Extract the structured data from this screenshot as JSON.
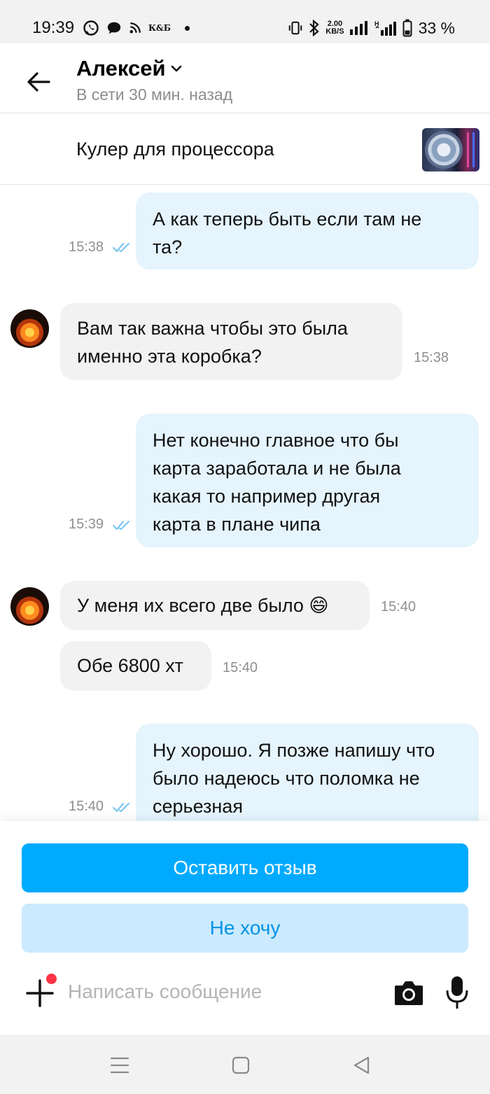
{
  "status_bar": {
    "time": "19:39",
    "carrier_badge": "К&Б",
    "net_speed": "2.00",
    "net_unit": "KB/S",
    "battery": "33 %",
    "signal_label": "H"
  },
  "header": {
    "name": "Алексей",
    "status": "В сети 30 мин. назад"
  },
  "product": {
    "title": "Кулер для процессора"
  },
  "messages": [
    {
      "dir": "out",
      "text_lines": [
        "А как теперь быть если там не",
        "та?"
      ],
      "time": "15:38",
      "read": true
    },
    {
      "dir": "in",
      "text_lines": [
        "Вам так важна чтобы это была",
        "именно эта коробка?"
      ],
      "time": "15:38"
    },
    {
      "dir": "out",
      "text_lines": [
        "Нет конечно главное что бы",
        "карта заработала и не была",
        "какая то например другая",
        "карта в плане чипа"
      ],
      "time": "15:39",
      "read": true
    },
    {
      "dir": "in",
      "text_lines": [
        "У меня их всего две было 😄"
      ],
      "time": "15:40"
    },
    {
      "dir": "in",
      "text_lines": [
        "Обе 6800 хт"
      ],
      "time": "15:40"
    },
    {
      "dir": "out",
      "text_lines": [
        "Ну хорошо. Я позже напишу что",
        "было надеюсь что поломка не",
        "серьезная"
      ],
      "time": "15:40",
      "read": true
    }
  ],
  "actions": {
    "review_button": "Оставить отзыв",
    "decline_button": "Не хочу"
  },
  "composer": {
    "placeholder": "Написать сообщение"
  },
  "colors": {
    "accent": "#00aaff",
    "outgoing_bubble": "#e5f4fd",
    "incoming_bubble": "#f2f2f2",
    "notification_dot": "#ff3347",
    "read_ticks": "#7cc8f0"
  }
}
